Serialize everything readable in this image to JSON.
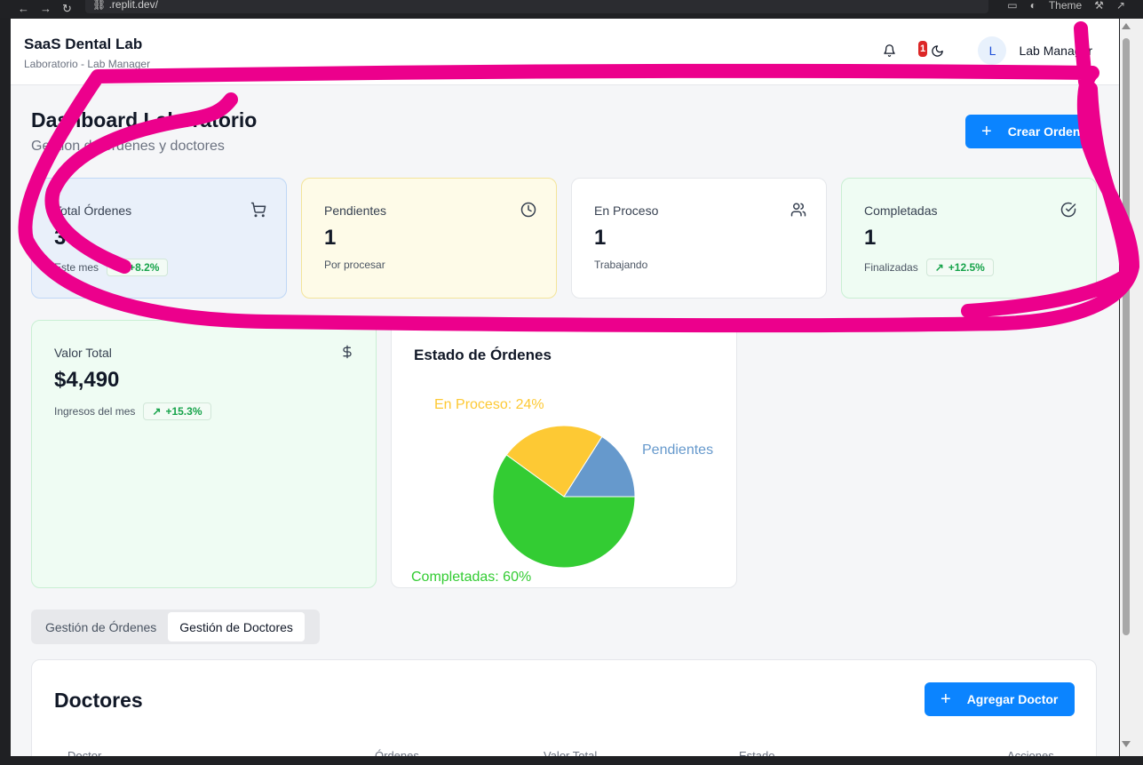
{
  "browser": {
    "url": ".replit.dev/",
    "theme_label": "Theme"
  },
  "header": {
    "app_title": "SaaS Dental Lab",
    "app_subtitle": "Laboratorio - Lab Manager",
    "notification_count": "1",
    "avatar_initial": "L",
    "user_name": "Lab Manager"
  },
  "page": {
    "title": "Dashboard Laboratorio",
    "subtitle": "Gestion de órdenes y doctores",
    "create_button": "Crear Orden"
  },
  "stats": {
    "total": {
      "label": "Total Órdenes",
      "value": "3",
      "foot": "Este mes",
      "trend": "+8.2%",
      "icon": "cart-icon"
    },
    "pending": {
      "label": "Pendientes",
      "value": "1",
      "foot": "Por procesar",
      "icon": "clock-icon"
    },
    "in_process": {
      "label": "En Proceso",
      "value": "1",
      "foot": "Trabajando",
      "icon": "users-icon"
    },
    "completed": {
      "label": "Completadas",
      "value": "1",
      "foot": "Finalizadas",
      "trend": "+12.5%",
      "icon": "check-circle-icon"
    },
    "total_value": {
      "label": "Valor Total",
      "value": "$4,490",
      "foot": "Ingresos del mes",
      "trend": "+15.3%",
      "icon": "dollar-icon"
    }
  },
  "chart_data": {
    "type": "pie",
    "title": "Estado de Órdenes",
    "slices": [
      {
        "label": "Pendientes",
        "value": 16,
        "color": "#6699cc"
      },
      {
        "label": "En Proceso: 24%",
        "value": 24,
        "color": "#fdc934"
      },
      {
        "label": "Completadas: 60%",
        "value": 60,
        "color": "#33cc33"
      }
    ],
    "visible_labels": {
      "pending": "Pendientes",
      "in_process": "En Proceso: 24%",
      "completed": "Completadas: 60%"
    }
  },
  "tabs": [
    {
      "label": "Gestión de Órdenes",
      "active": false
    },
    {
      "label": "Gestión de Doctores",
      "active": true
    }
  ],
  "doctors": {
    "title": "Doctores",
    "add_button": "Agregar Doctor",
    "columns": [
      "Doctor",
      "Órdenes",
      "Valor Total",
      "Estado",
      "Acciones"
    ]
  },
  "colors": {
    "primary": "#0b84ff",
    "success": "#16a34a",
    "annotation": "#ec008c",
    "badge": "#dc2626"
  }
}
